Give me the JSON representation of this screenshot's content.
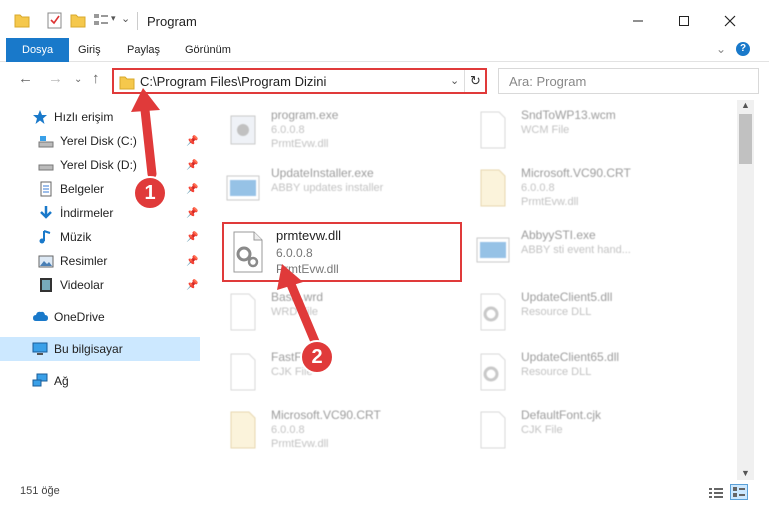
{
  "window": {
    "title": "Program",
    "minimize_icon": "minimize-icon",
    "maximize_icon": "maximize-icon",
    "close_icon": "close-icon"
  },
  "ribbon": {
    "tabs": [
      "Dosya",
      "Giriş",
      "Paylaş",
      "Görünüm"
    ]
  },
  "address": {
    "path": "C:\\Program Files\\Program Dizini",
    "search_placeholder": "Ara: Program"
  },
  "sidebar": {
    "items": [
      {
        "label": "Hızlı erişim",
        "icon": "star-icon"
      },
      {
        "label": "Yerel Disk (C:)",
        "icon": "drive-icon"
      },
      {
        "label": "Yerel Disk (D:)",
        "icon": "drive-icon"
      },
      {
        "label": "Belgeler",
        "icon": "documents-icon"
      },
      {
        "label": "İndirmeler",
        "icon": "download-icon"
      },
      {
        "label": "Müzik",
        "icon": "music-icon"
      },
      {
        "label": "Resimler",
        "icon": "pictures-icon"
      },
      {
        "label": "Videolar",
        "icon": "videos-icon"
      },
      {
        "label": "OneDrive",
        "icon": "cloud-icon"
      },
      {
        "label": "Bu bilgisayar",
        "icon": "computer-icon"
      },
      {
        "label": "Ağ",
        "icon": "network-icon"
      }
    ]
  },
  "files": {
    "left": [
      {
        "name": "program.exe",
        "sub1": "6.0.0.8",
        "sub2": "PrmtEvw.dll"
      },
      {
        "name": "UpdateInstaller.exe",
        "sub1": "ABBY updates installer",
        "sub2": ""
      },
      {
        "name": "prmtevw.dll",
        "sub1": "6.0.0.8",
        "sub2": "PrmtEvw.dll"
      },
      {
        "name": "Basic.wrd",
        "sub1": "WRD File",
        "sub2": ""
      },
      {
        "name": "FastFile.cjk",
        "sub1": "CJK File",
        "sub2": ""
      },
      {
        "name": "Microsoft.VC90.CRT",
        "sub1": "6.0.0.8",
        "sub2": "PrmtEvw.dll"
      }
    ],
    "right": [
      {
        "name": "SndToWP13.wcm",
        "sub1": "WCM File",
        "sub2": ""
      },
      {
        "name": "Microsoft.VC90.CRT",
        "sub1": "6.0.0.8",
        "sub2": "PrmtEvw.dll"
      },
      {
        "name": "AbbyySTI.exe",
        "sub1": "ABBY sti event hand...",
        "sub2": ""
      },
      {
        "name": "UpdateClient5.dll",
        "sub1": "Resource DLL",
        "sub2": ""
      },
      {
        "name": "UpdateClient65.dll",
        "sub1": "Resource DLL",
        "sub2": ""
      },
      {
        "name": "DefaultFont.cjk",
        "sub1": "CJK File",
        "sub2": ""
      }
    ]
  },
  "status": {
    "count": "151 öğe"
  },
  "annotations": {
    "badge1": "1",
    "badge2": "2"
  },
  "colors": {
    "accent": "#1979ca",
    "annotation": "#e03a3a",
    "selected": "#cce8ff"
  }
}
